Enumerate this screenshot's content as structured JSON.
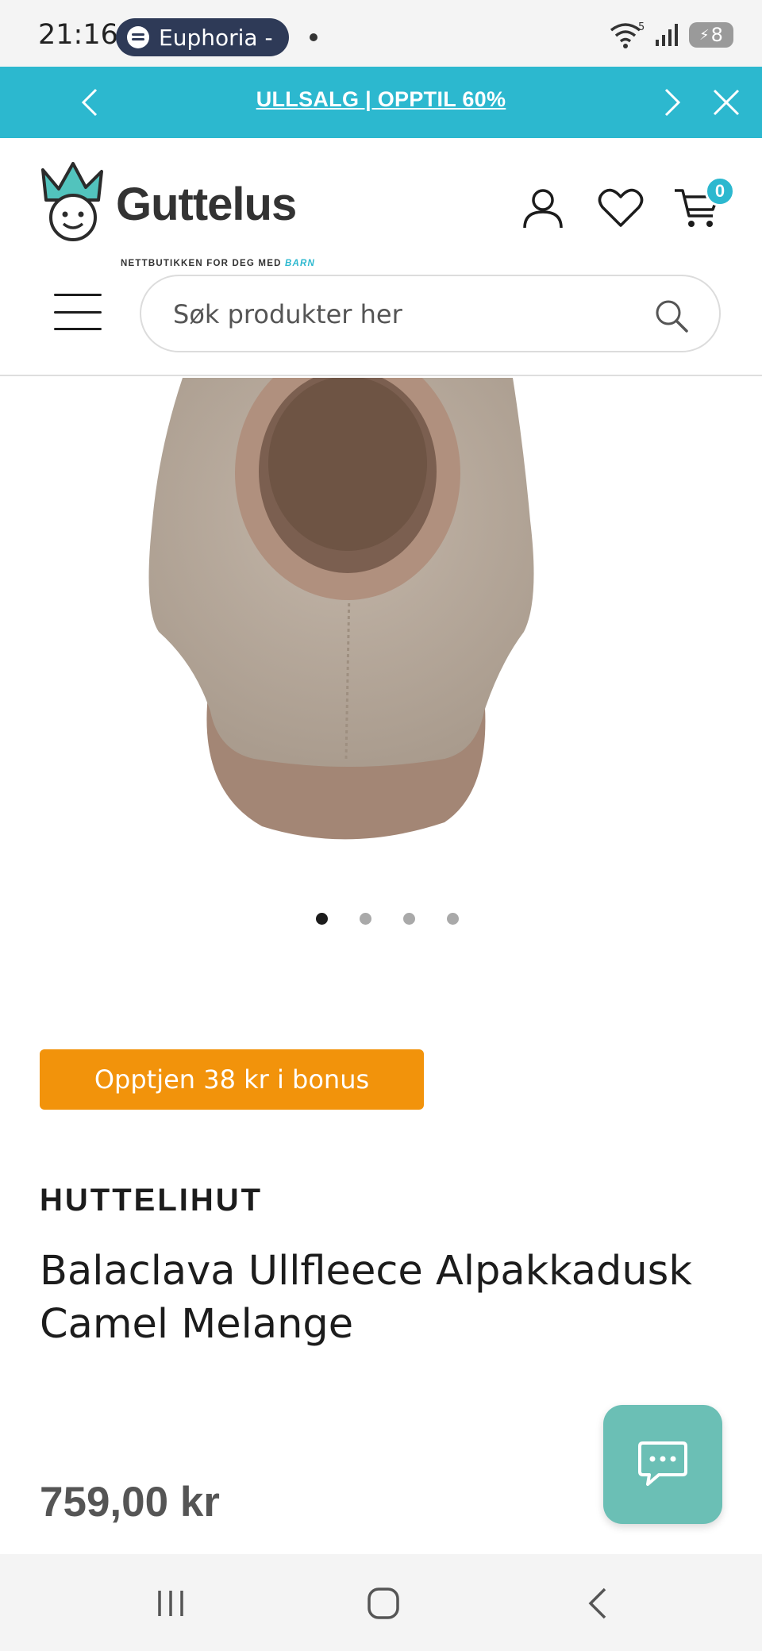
{
  "status_bar": {
    "time": "21:16",
    "media_title": "Euphoria - ",
    "network": "5",
    "battery": "8"
  },
  "promo": {
    "text": "ULLSALG | OPPTIL 60%"
  },
  "header": {
    "logo_name": "Guttelus",
    "logo_tagline": "NETTBUTIKKEN FOR DEG MED",
    "logo_tagline_accent": "BARN",
    "cart_count": "0",
    "search_placeholder": "Søk produkter her"
  },
  "carousel": {
    "slides": 4,
    "active": 1
  },
  "product": {
    "bonus": "Opptjen 38 kr i bonus",
    "brand": "HUTTELIHUT",
    "title": "Balaclava Ullfleece Alpakkadusk Camel Melange",
    "price": "759,00 kr"
  },
  "colors": {
    "accent": "#2cb8cf",
    "bonus": "#f2930b",
    "chat": "#6bbfb5"
  }
}
